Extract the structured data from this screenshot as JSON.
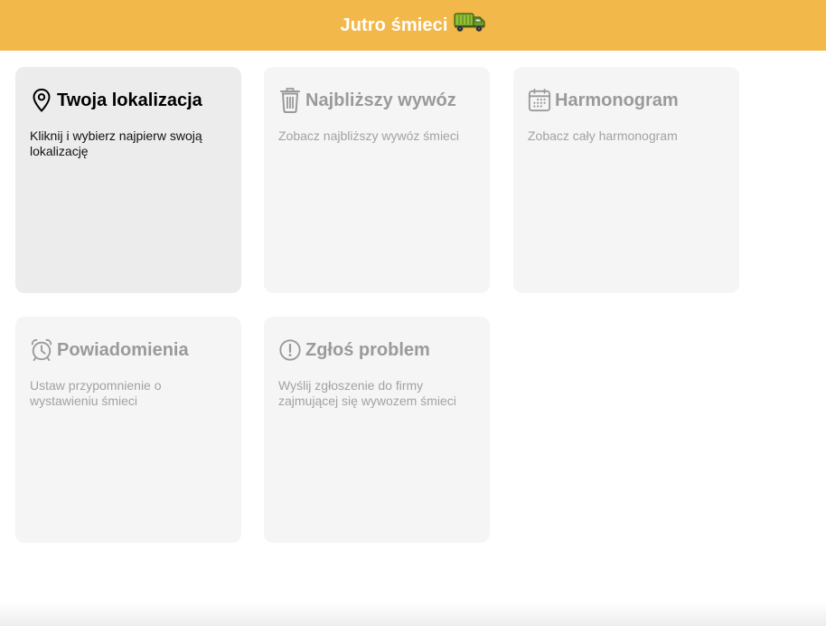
{
  "header": {
    "title": "Jutro śmieci",
    "truck_icon": "garbage-truck-icon",
    "background": "#f3b84a"
  },
  "cards": [
    {
      "key": "location",
      "icon": "location-pin-icon",
      "title": "Twoja lokalizacja",
      "description": "Kliknij i wybierz najpierw swoją lokalizację",
      "active": true
    },
    {
      "key": "next-pickup",
      "icon": "trash-can-icon",
      "title": "Najbliższy wywóz",
      "description": "Zobacz najbliższy wywóz śmieci",
      "active": false
    },
    {
      "key": "schedule",
      "icon": "calendar-icon",
      "title": "Harmonogram",
      "description": "Zobacz cały harmonogram",
      "active": false
    },
    {
      "key": "notifications",
      "icon": "alarm-clock-icon",
      "title": "Powiadomienia",
      "description": "Ustaw przypomnienie o wystawieniu śmieci",
      "active": false
    },
    {
      "key": "report",
      "icon": "exclamation-circle-icon",
      "title": "Zgłoś problem",
      "description": "Wyślij zgłoszenie do firmy zajmującej się wywozem śmieci",
      "active": false
    }
  ]
}
